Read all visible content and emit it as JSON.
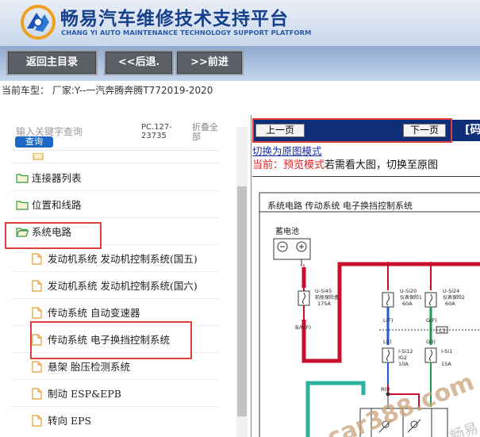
{
  "header": {
    "title": "畅易汽车维修技术支持平台",
    "subtitle": "CHANG YI AUTO MAINTENANCE TECHNOLOGY SUPPORT PLATFORM"
  },
  "toolbar": {
    "home_label": "返回主目录",
    "back_label": "<<后退.",
    "forward_label": ">>前进"
  },
  "model": {
    "text": "当前车型： 厂家:Y--一汽奔腾奔腾T772019-2020"
  },
  "search": {
    "placeholder": "输入关键字查询",
    "button": "查询",
    "code": "PC.127-23735",
    "collapse": "折叠全部"
  },
  "tree": {
    "items": [
      {
        "label": "连接器列表",
        "type": "folder"
      },
      {
        "label": "位置和线路",
        "type": "folder"
      },
      {
        "label": "系统电路",
        "type": "folder-open"
      },
      {
        "label": "发动机系统 发动机控制系统(国五)",
        "type": "doc"
      },
      {
        "label": "发动机系统 发动机控制系统(国六)",
        "type": "doc"
      },
      {
        "label": "传动系统 自动变速器",
        "type": "doc"
      },
      {
        "label": "传动系统 电子换挡控制系统",
        "type": "doc"
      },
      {
        "label": "悬架 胎压检测系统",
        "type": "doc"
      },
      {
        "label": "制动 ESP&EPB",
        "type": "doc"
      },
      {
        "label": "转向 EPS",
        "type": "doc"
      }
    ]
  },
  "viewer": {
    "prev": "上一页",
    "next": "下一页",
    "switch_link": "切换为原图模式",
    "current_prefix": "当前：预览模式",
    "current_suffix": "若需看大图，切换至原图",
    "nav_cut": "[码"
  },
  "diagram": {
    "title": "系统电路 传动系统 电子换挡控制系统",
    "battery": "蓄电池",
    "fuse1_name": "U-Si45",
    "fuse1_desc": "前舱保险盒",
    "fuse1_amp": "175A",
    "fuse2_name": "U-Si20",
    "fuse2_desc": "仪表保险1",
    "fuse2_amp": "60A",
    "fuse3_name": "U-Si24",
    "fuse3_desc": "仪表保险2",
    "fuse3_amp": "60A",
    "wire1": "B/R(F)",
    "wire2": "L(F)",
    "wire3": "G(F)",
    "wire4": "L(I)",
    "wire5": "G(I)",
    "fuse4_name": "I-Si12",
    "fuse4_desc": "IG2",
    "fuse4_amp": "10A",
    "fuse5_name": "I-Si1",
    "fuse5_amp": "15A",
    "conn": "C3",
    "wire6": "R(I)",
    "watermark": "car388.com",
    "watermark2": "畅易"
  },
  "colors": {
    "accent": "#0f2e78",
    "highlight": "#e0403e",
    "wire_red": "#c8102e",
    "wire_green": "#1f9a55",
    "wire_blue": "#1e5bd6"
  }
}
